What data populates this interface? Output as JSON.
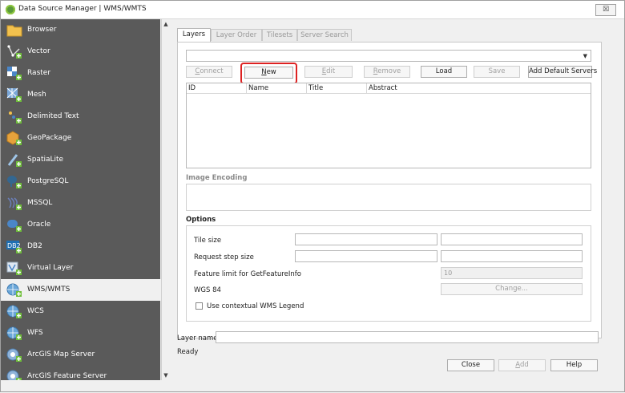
{
  "window": {
    "title": "Data Source Manager | WMS/WMTS",
    "close_label": "☒"
  },
  "sidebar": {
    "items": [
      {
        "label": "Browser",
        "icon": "folder-icon"
      },
      {
        "label": "Vector",
        "icon": "vector-icon"
      },
      {
        "label": "Raster",
        "icon": "raster-icon"
      },
      {
        "label": "Mesh",
        "icon": "mesh-icon"
      },
      {
        "label": "Delimited Text",
        "icon": "delimited-text-icon"
      },
      {
        "label": "GeoPackage",
        "icon": "geopackage-icon"
      },
      {
        "label": "SpatiaLite",
        "icon": "spatialite-icon"
      },
      {
        "label": "PostgreSQL",
        "icon": "postgresql-icon"
      },
      {
        "label": "MSSQL",
        "icon": "mssql-icon"
      },
      {
        "label": "Oracle",
        "icon": "oracle-icon"
      },
      {
        "label": "DB2",
        "icon": "db2-icon"
      },
      {
        "label": "Virtual Layer",
        "icon": "virtual-layer-icon"
      },
      {
        "label": "WMS/WMTS",
        "icon": "wms-icon"
      },
      {
        "label": "WCS",
        "icon": "wcs-icon"
      },
      {
        "label": "WFS",
        "icon": "wfs-icon"
      },
      {
        "label": "ArcGIS Map Server",
        "icon": "arcgis-map-icon"
      },
      {
        "label": "ArcGIS Feature Server",
        "icon": "arcgis-feature-icon"
      }
    ],
    "db2_badge": "DB2"
  },
  "tabs": [
    "Layers",
    "Layer Order",
    "Tilesets",
    "Server Search"
  ],
  "toolbar": {
    "connect": "Connect",
    "new": "New",
    "edit": "Edit",
    "remove": "Remove",
    "load": "Load",
    "save": "Save",
    "add_default": "Add Default Servers"
  },
  "table": {
    "columns": [
      "ID",
      "Name",
      "Title",
      "Abstract"
    ]
  },
  "image_encoding": {
    "label": "Image Encoding"
  },
  "options": {
    "label": "Options",
    "tile_size": "Tile size",
    "request_step_size": "Request step size",
    "feature_limit": "Feature limit for GetFeatureInfo",
    "feature_limit_value": "10",
    "wgs84": "WGS 84",
    "change": "Change...",
    "contextual_legend": "Use contextual WMS Legend"
  },
  "bottom": {
    "layer_name": "Layer name",
    "status": "Ready",
    "close": "Close",
    "add": "Add",
    "help": "Help"
  },
  "colors": {
    "sidebar_bg": "#5a5a5a",
    "highlight": "#dd2222"
  }
}
